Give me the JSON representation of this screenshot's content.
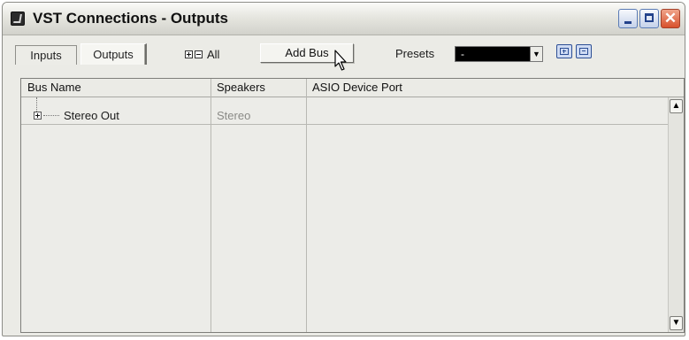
{
  "window": {
    "title": "VST Connections - Outputs",
    "controls": {
      "minimize": "_",
      "maximize": "□",
      "close": "✕"
    }
  },
  "toolbar": {
    "tabs": [
      {
        "label": "Inputs",
        "selected": false
      },
      {
        "label": "Outputs",
        "selected": true
      }
    ],
    "expand_all_label": "All",
    "add_bus_label": "Add Bus",
    "presets_label": "Presets",
    "presets_value": "-",
    "preset_icons": [
      "store-preset-icon",
      "remove-preset-icon"
    ]
  },
  "table": {
    "columns": [
      "Bus Name",
      "Speakers",
      "ASIO Device Port"
    ],
    "rows": [
      {
        "bus_name": "Stereo Out",
        "speakers": "Stereo",
        "asio_device_port": "",
        "expanded": false
      }
    ]
  },
  "colors": {
    "window_bg": "#ebebe6",
    "presets_field_bg": "#000000",
    "close_button": "#d8512d",
    "title_button_accent": "#23428b"
  }
}
